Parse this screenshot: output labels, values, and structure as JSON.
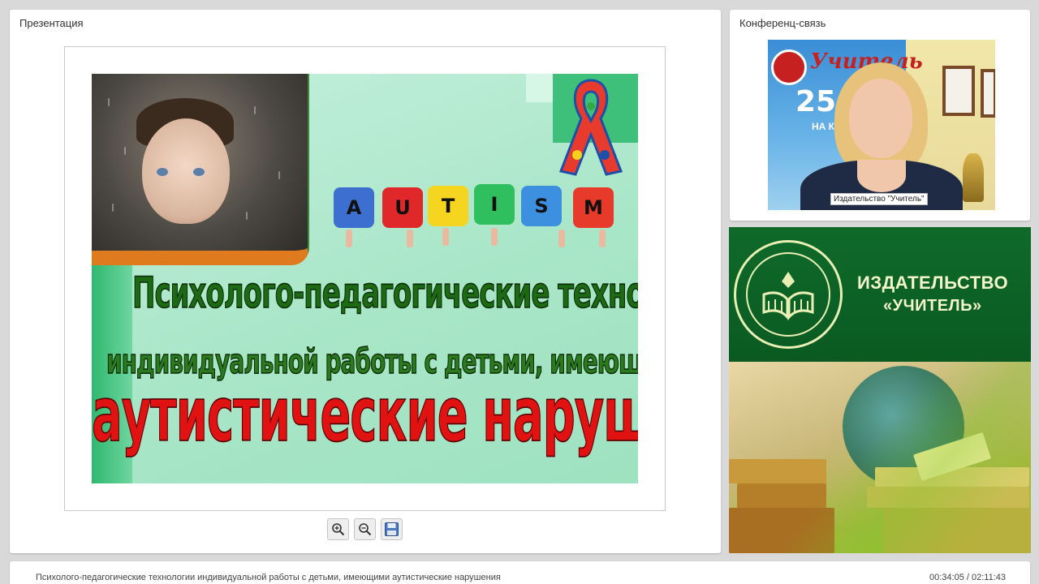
{
  "presentation_panel": {
    "title": "Презентация",
    "slide": {
      "autism_letters": [
        "A",
        "U",
        "T",
        "I",
        "S",
        "M"
      ],
      "line1": "Психолого-педагогические  технологии",
      "line2": "индивидуальной работы с детьми, имеющими",
      "line3": "аутистические  нарушения"
    },
    "toolbar": {
      "zoom_in_icon": "zoom-in-icon",
      "zoom_out_icon": "zoom-out-icon",
      "save_icon": "save-icon"
    }
  },
  "conference_panel": {
    "title": "Конференц-связь",
    "video": {
      "caption": "Издательство \"Учитель\"",
      "banner_title": "Учитель",
      "banner_number": "25",
      "banner_sub": "НА КНИЖ"
    }
  },
  "publisher_banner": {
    "name_line1": "ИЗДАТЕЛЬСТВО",
    "name_line2": "«УЧИТЕЛЬ»"
  },
  "info_bar": {
    "title": "Психолого-педагогические технологии индивидуальной работы с детьми, имеющими аутистические нарушения",
    "time": "00:34:05 / 02:11:43"
  },
  "colors": {
    "background": "#d9d9d9",
    "publisher_green": "#0f6a2a",
    "slide_red": "#e01212",
    "slide_green": "#1c6b14"
  }
}
